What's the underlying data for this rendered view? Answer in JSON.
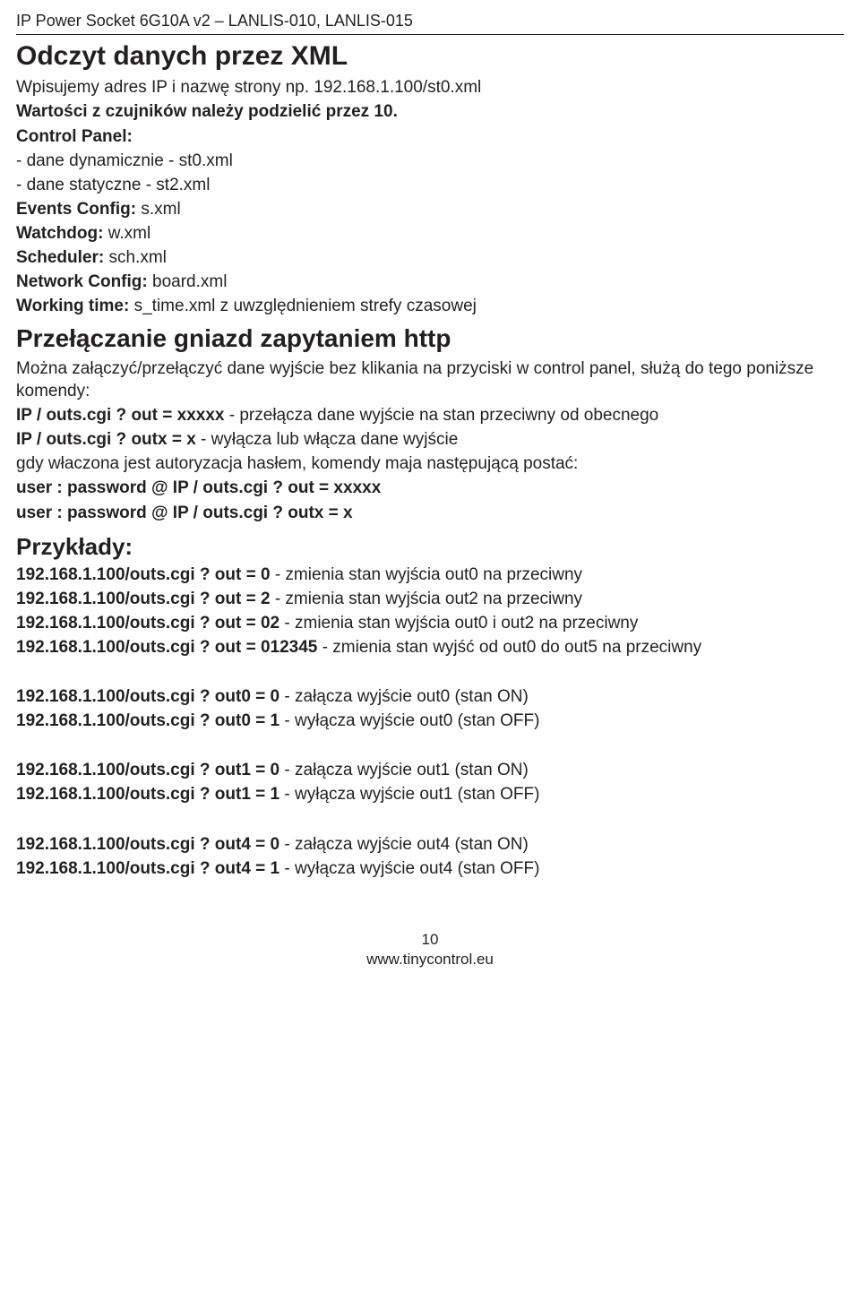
{
  "header": "IP Power Socket 6G10A v2 – LANLIS-010, LANLIS-015",
  "section1": {
    "title": "Odczyt danych przez XML",
    "intro": "Wpisujemy adres IP i nazwę strony np. 192.168.1.100/st0.xml",
    "note_bold": "Wartości z czujników należy podzielić przez 10.",
    "cp_label": "Control Panel:",
    "cp_l1": "- dane dynamicznie - st0.xml",
    "cp_l2": "- dane statyczne - st2.xml",
    "ev_label": "Events Config:",
    "ev_val": " s.xml",
    "wd_label": "Watchdog:",
    "wd_val": " w.xml",
    "sch_label": "Scheduler:",
    "sch_val": " sch.xml",
    "net_label": "Network Config:",
    "net_val": " board.xml",
    "wt_label": "Working time:",
    "wt_val": " s_time.xml   z uwzględnieniem strefy czasowej"
  },
  "section2": {
    "title": "Przełączanie gniazd zapytaniem http",
    "p1": "Można załączyć/przełączyć dane wyjście bez klikania na przyciski w control panel, służą do tego poniższe komendy:",
    "c1_b": "IP / outs.cgi ? out = xxxxx",
    "c1_t": " - przełącza dane wyjście na stan przeciwny od obecnego",
    "c2_b": "IP / outs.cgi ? outx = x",
    "c2_t": " - wyłącza lub włącza dane wyjście",
    "auth": "gdy właczona jest autoryzacja hasłem, komendy maja następującą postać:",
    "a1": "user : password @ IP / outs.cgi ? out = xxxxx",
    "a2": "user : password @ IP / outs.cgi ? outx = x"
  },
  "section3": {
    "title": "Przykłady:",
    "e1_b": "192.168.1.100/outs.cgi ? out = 0",
    "e1_t": " - zmienia stan wyjścia out0 na przeciwny",
    "e2_b": "192.168.1.100/outs.cgi ? out = 2",
    "e2_t": " - zmienia stan wyjścia out2 na przeciwny",
    "e3_b": "192.168.1.100/outs.cgi ? out = 02",
    "e3_t": " - zmienia stan wyjścia out0 i out2 na przeciwny",
    "e4_b": "192.168.1.100/outs.cgi ? out = 012345",
    "e4_t": " - zmienia stan wyjść od out0 do out5 na przeciwny",
    "e5_b": "192.168.1.100/outs.cgi ? out0 = 0",
    "e5_t": " - załącza wyjście out0 (stan ON)",
    "e6_b": "192.168.1.100/outs.cgi ? out0 = 1",
    "e6_t": " - wyłącza wyjście out0 (stan OFF)",
    "e7_b": "192.168.1.100/outs.cgi ? out1 = 0",
    "e7_t": " - załącza wyjście out1 (stan ON)",
    "e8_b": "192.168.1.100/outs.cgi ? out1 = 1",
    "e8_t": " - wyłącza wyjście out1 (stan OFF)",
    "e9_b": "192.168.1.100/outs.cgi ? out4 = 0",
    "e9_t": " - załącza wyjście out4 (stan ON)",
    "e10_b": "192.168.1.100/outs.cgi ? out4 = 1",
    "e10_t": " - wyłącza wyjście out4 (stan OFF)"
  },
  "footer": {
    "page": "10",
    "site": "www.tinycontrol.eu"
  }
}
